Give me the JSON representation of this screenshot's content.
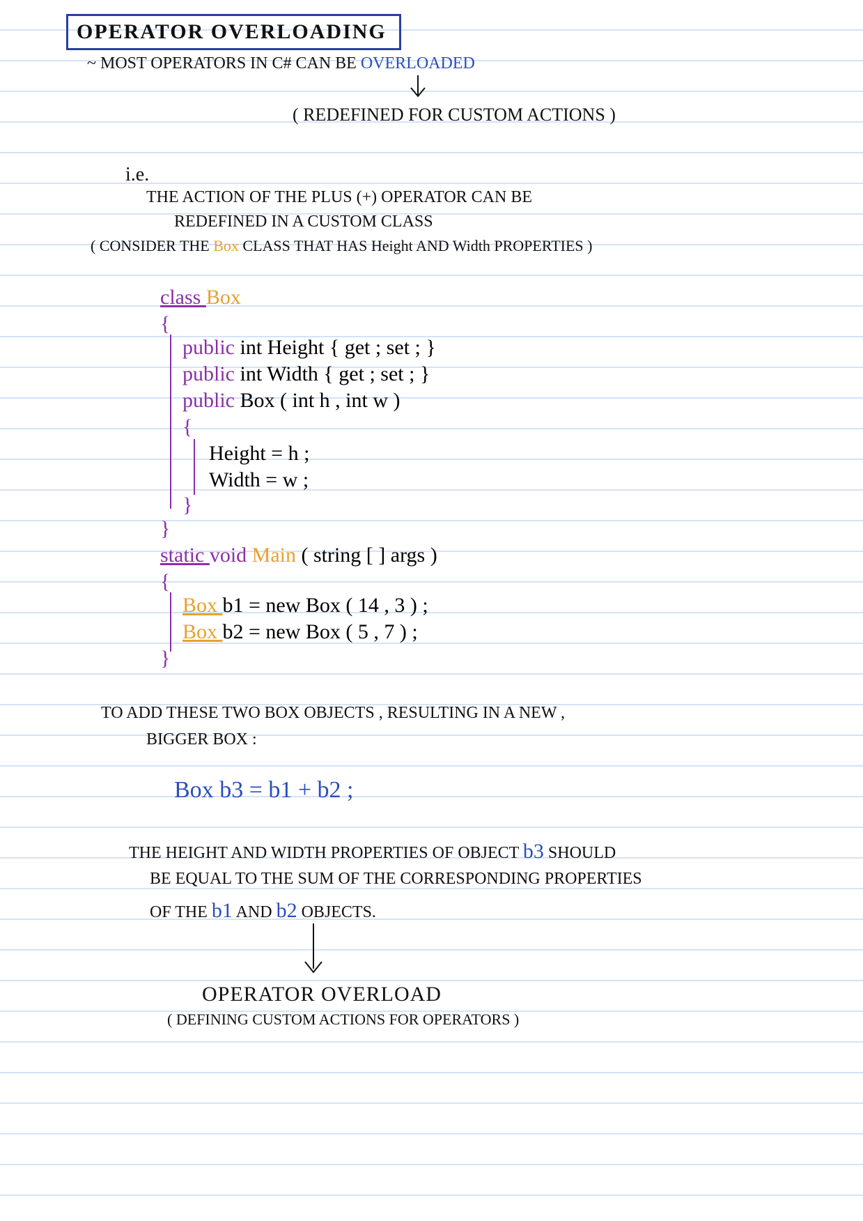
{
  "title": "OPERATOR OVERLOADING",
  "intro_prefix": "~ MOST OPERATORS IN C# CAN BE ",
  "intro_overloaded": "OVERLOADED",
  "redefined": "( REDEFINED FOR CUSTOM ACTIONS )",
  "ie": "i.e.",
  "ie_line1": "THE ACTION OF THE PLUS (+) OPERATOR CAN BE",
  "ie_line2": "REDEFINED IN A CUSTOM CLASS",
  "consider_pre": "( CONSIDER THE ",
  "consider_box": "Box",
  "consider_mid": " CLASS THAT HAS ",
  "consider_h": "Height",
  "consider_and": " AND ",
  "consider_w": "Width",
  "consider_post": " PROPERTIES )",
  "code": {
    "l1_class": "class ",
    "l1_box": "Box",
    "l2": "{",
    "l3_pub": "public ",
    "l3_rest": "int Height { get ; set ; }",
    "l4_pub": "public ",
    "l4_rest": "int Width { get ; set ; }",
    "l5_pub": "public ",
    "l5_rest": "Box ( int h , int w )",
    "l6": "{",
    "l7": "Height = h ;",
    "l8": "Width = w ;",
    "l9": "}",
    "l10": "}",
    "l11_static": "static ",
    "l11_void": "void ",
    "l11_main": "Main ",
    "l11_args": "( string [ ] args )",
    "l12": "{",
    "l13_box": "Box ",
    "l13_rest": "b1 = new Box ( 14 , 3 ) ;",
    "l14_box": "Box ",
    "l14_rest": "b2 = new Box ( 5 , 7 ) ;",
    "l15": "}"
  },
  "add_line1": "TO ADD THESE TWO BOX OBJECTS , RESULTING IN A NEW ,",
  "add_line2": "BIGGER BOX :",
  "b3_expr_box": "Box ",
  "b3_expr_rest": "b3 = b1 + b2 ;",
  "hw_pre": "THE HEIGHT AND WIDTH PROPERTIES OF OBJECT ",
  "hw_b3": "b3",
  "hw_post": " SHOULD",
  "hw_line2": "BE EQUAL TO THE SUM OF THE CORRESPONDING PROPERTIES",
  "hw_line3_pre": "OF THE ",
  "hw_b1": "b1",
  "hw_and": " AND ",
  "hw_b2": "b2",
  "hw_line3_post": " OBJECTS.",
  "op_overload": "OPERATOR OVERLOAD",
  "op_sub": "( DEFINING CUSTOM ACTIONS FOR OPERATORS )"
}
